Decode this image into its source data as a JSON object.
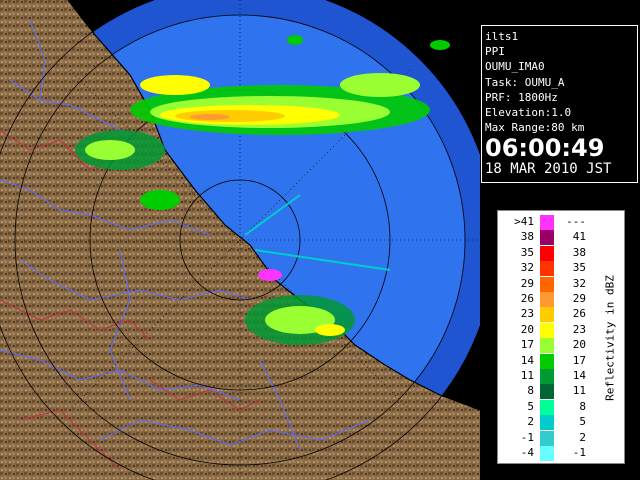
{
  "info": {
    "station": "ilts1",
    "product": "PPI",
    "site": "OUMU_IMA0",
    "task": "Task: OUMU_A",
    "prf": "PRF: 1800Hz",
    "elevation": "Elevation:1.0",
    "max_range": "Max Range:80 km",
    "time": "06:00:49",
    "date": "18 MAR 2010 JST"
  },
  "legend": {
    "title": "Reflectivity in dBZ",
    "rows": [
      {
        "low": ">41",
        "high": "---",
        "color": "#ff33ff"
      },
      {
        "low": "38",
        "high": "41",
        "color": "#990066"
      },
      {
        "low": "35",
        "high": "38",
        "color": "#ff0000"
      },
      {
        "low": "32",
        "high": "35",
        "color": "#ff3300"
      },
      {
        "low": "29",
        "high": "32",
        "color": "#ff6600"
      },
      {
        "low": "26",
        "high": "29",
        "color": "#ff9933"
      },
      {
        "low": "23",
        "high": "26",
        "color": "#ffcc00"
      },
      {
        "low": "20",
        "high": "23",
        "color": "#ffff00"
      },
      {
        "low": "17",
        "high": "20",
        "color": "#99ff33"
      },
      {
        "low": "14",
        "high": "17",
        "color": "#00cc00"
      },
      {
        "low": "11",
        "high": "14",
        "color": "#009933"
      },
      {
        "low": "8",
        "high": "11",
        "color": "#006633"
      },
      {
        "low": "5",
        "high": "8",
        "color": "#00ff99"
      },
      {
        "low": "2",
        "high": "5",
        "color": "#00cccc"
      },
      {
        "low": "-1",
        "high": "2",
        "color": "#33cccc"
      },
      {
        "low": "-4",
        "high": "-1",
        "color": "#66ffff"
      }
    ]
  },
  "colors": {
    "sea": "#2a6ee8",
    "sea_outer": "#1a4fc0",
    "land": "#8a6a45",
    "land_dark": "#4a3520",
    "river": "#5b6cff",
    "border": "#c03040",
    "range_ring": "#000000"
  }
}
